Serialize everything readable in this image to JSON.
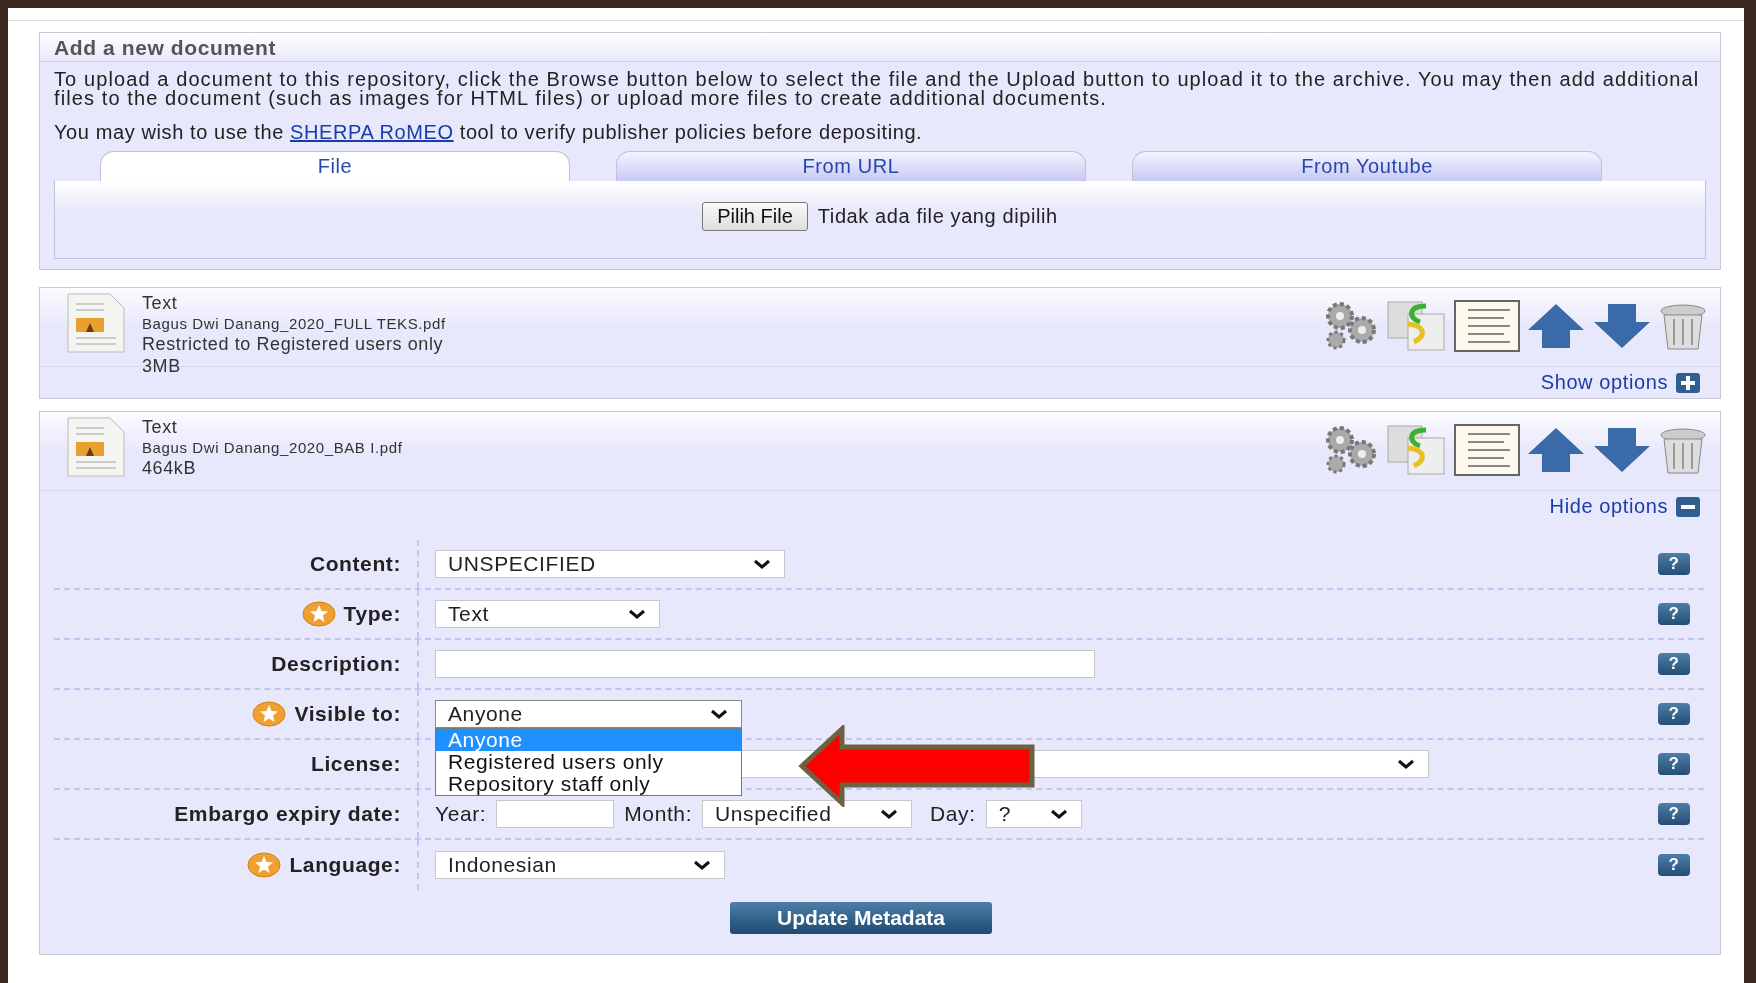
{
  "section_title": "Add a new document",
  "intro": "To upload a document to this repository, click the Browse button below to select the file and the Upload button to upload it to the archive. You may then add additional files to the document (such as images for HTML files) or upload more files to create additional documents.",
  "hint": {
    "before": "You may wish to use the ",
    "link": "SHERPA RoMEO",
    "after": " tool to verify publisher policies before depositing."
  },
  "tabs": [
    {
      "label": "File",
      "selected": true
    },
    {
      "label": "From URL",
      "selected": false
    },
    {
      "label": "From Youtube",
      "selected": false
    }
  ],
  "file_picker": {
    "button": "Pilih File",
    "status": "Tidak ada file yang dipilih"
  },
  "documents": [
    {
      "type": "Text",
      "filename": "Bagus Dwi Danang_2020_FULL TEKS.pdf",
      "access": "Restricted to Registered users only",
      "size": "3MB",
      "expanded": false,
      "toggle": "Show options"
    },
    {
      "type": "Text",
      "filename": "Bagus Dwi Danang_2020_BAB I.pdf",
      "size": "464kB",
      "expanded": true,
      "toggle": "Hide options"
    }
  ],
  "form": {
    "rows": [
      {
        "kind": "select",
        "label": "Content:",
        "required": false,
        "value": "UNSPECIFIED",
        "help": "?"
      },
      {
        "kind": "select",
        "label": "Type:",
        "required": true,
        "value": "Text",
        "help": "?"
      },
      {
        "kind": "text",
        "label": "Description:",
        "required": false,
        "help": "?"
      },
      {
        "kind": "select",
        "label": "Visible to:",
        "required": true,
        "value": "Anyone",
        "expanded": true,
        "options": [
          {
            "label": "Anyone",
            "selected": true
          },
          {
            "label": "Registered users only",
            "selected": false
          },
          {
            "label": "Repository staff only",
            "selected": false
          }
        ],
        "help": "?"
      },
      {
        "kind": "select",
        "label": "License:",
        "required": false,
        "help": "?"
      },
      {
        "kind": "date",
        "label": "Embargo expiry date:",
        "required": false,
        "year_label": "Year:",
        "month_label": "Month:",
        "month": "Unspecified",
        "day_label": "Day:",
        "day": "?",
        "help": "?"
      },
      {
        "kind": "select",
        "label": "Language:",
        "required": true,
        "value": "Indonesian",
        "help": "?"
      }
    ],
    "submit": "Update Metadata"
  }
}
